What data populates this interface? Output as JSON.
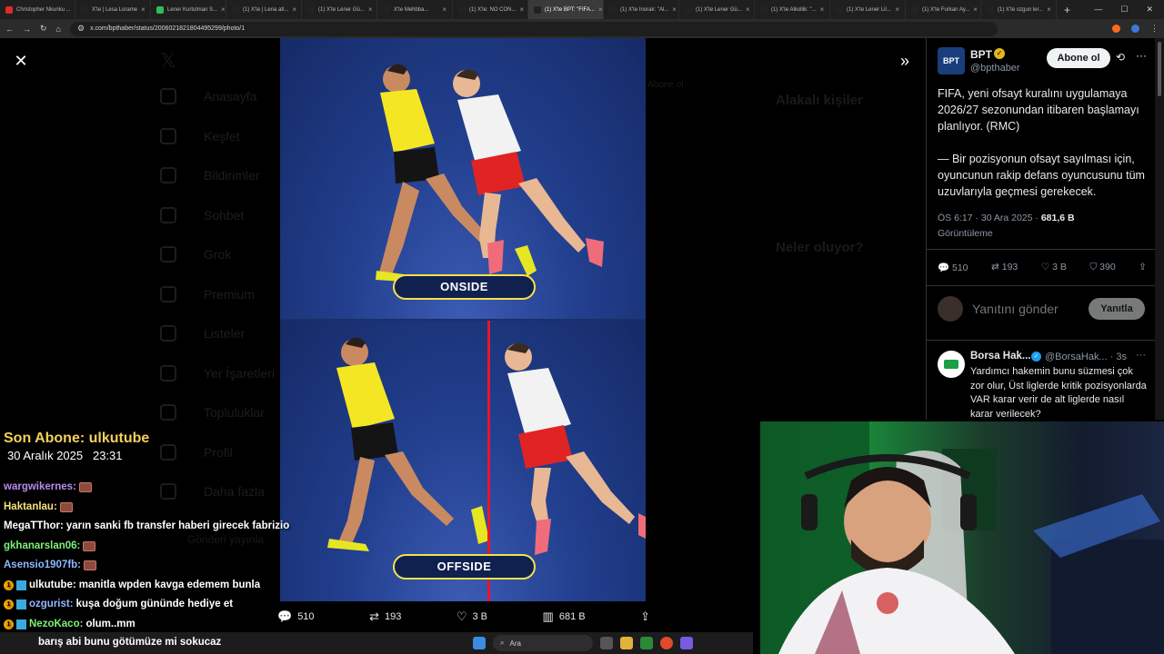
{
  "browser": {
    "tabs": [
      {
        "label": "Christopher Nkunku ...",
        "icon_color": "#e02a2a",
        "active": false
      },
      {
        "label": "X'te | Lesa Lorame",
        "icon_color": "#222222",
        "active": false
      },
      {
        "label": "Lener Kurtulman S...",
        "icon_color": "#2ebd59",
        "active": false
      },
      {
        "label": "(1) X'te | Lena atl...",
        "icon_color": "#222222",
        "active": false
      },
      {
        "label": "(1) X'te Lener Gü...",
        "icon_color": "#222222",
        "active": false
      },
      {
        "label": "X'te Mehbba...",
        "icon_color": "#222222",
        "active": false
      },
      {
        "label": "(1) X'te: NO CON...",
        "icon_color": "#222222",
        "active": false
      },
      {
        "label": "(1) X'te BPT: \"FIFA...",
        "icon_color": "#222222",
        "active": true
      },
      {
        "label": "(1) X'te Inorak: \"Al...",
        "icon_color": "#222222",
        "active": false
      },
      {
        "label": "(1) X'te Lener Gü...",
        "icon_color": "#222222",
        "active": false
      },
      {
        "label": "(1) X'te Alkollik: \"...",
        "icon_color": "#222222",
        "active": false
      },
      {
        "label": "(1) X'te Lener Lil...",
        "icon_color": "#222222",
        "active": false
      },
      {
        "label": "(1) X'te Furkan Ay...",
        "icon_color": "#222222",
        "active": false
      },
      {
        "label": "(1) X'te ozgun ler...",
        "icon_color": "#222222",
        "active": false
      }
    ],
    "new_tab": "+",
    "url": "x.com/bpthaber/status/2006021821804495299/photo/1"
  },
  "background_page": {
    "nav": [
      "Anasayfa",
      "Keşfet",
      "Bildirimler",
      "Sohbet",
      "Grok",
      "Premium",
      "Listeler",
      "Yer İşaretleri",
      "Topluluklar",
      "Profil",
      "Daha fazla"
    ],
    "post_button": "Gönderi yayınla",
    "sidebar_title_1": "Alakalı kişiler",
    "sidebar_title_2": "Neler oluyor?",
    "follow_chip": "Abone ol"
  },
  "photo": {
    "top_label": "ONSIDE",
    "bottom_label": "OFFSIDE"
  },
  "photo_actions": {
    "replies": "510",
    "reposts": "193",
    "likes": "3 B",
    "views": "681 B"
  },
  "tweet": {
    "avatar_text": "BPT",
    "author_name": "BPT",
    "author_handle": "@bpthaber",
    "follow_label": "Abone ol",
    "text": "FIFA, yeni ofsayt kuralını uygulamaya 2026/27 sezonundan itibaren başlamayı planlıyor. (RMC)\n\n— Bir pozisyonun ofsayt sayılması için, oyuncunun rakip defans oyuncusunu tüm uzuvlarıyla geçmesi gerekecek.",
    "time": "ÖS 6:17 · 30 Ara 2025 · ",
    "views": "681,6 B",
    "views_label": "Görüntüleme",
    "replies": "510",
    "reposts": "193",
    "likes": "3 B",
    "bookmarks": "390",
    "reply_placeholder": "Yanıtını gönder",
    "reply_button": "Yanıtla"
  },
  "reply": {
    "name": "Borsa Hak...",
    "handle": "@BorsaHak... · 3s",
    "text": "Yardımcı hakemin bunu süzmesi çok zor olur, Üst liglerde kritik pozisyonlarda VAR karar verir de alt liglerde nasıl karar verilecek?"
  },
  "stream": {
    "sub_title": "Son Abone: ulkutube",
    "sub_date": "30 Aralık 2025",
    "sub_time": "23:31",
    "chat": [
      {
        "user": "wargwikernes:",
        "color": "#b98cf0",
        "text": "",
        "emote": true,
        "badges": false
      },
      {
        "user": "Haktanlau:",
        "color": "#f6e27a",
        "text": "",
        "emote": true,
        "badges": false
      },
      {
        "user": "MegaTThor:",
        "color": "#ffffff",
        "text": "yarın sanki fb transfer haberi girecek fabrizio",
        "emote": false,
        "badges": false
      },
      {
        "user": "gkhanarslan06:",
        "color": "#7ef07a",
        "text": "",
        "emote": true,
        "badges": false
      },
      {
        "user": "Asensio1907fb:",
        "color": "#8fb8ff",
        "text": "",
        "emote": true,
        "badges": false
      },
      {
        "user": "ulkutube:",
        "color": "#ffffff",
        "text": "manitla wpden kavga edemem bunla",
        "emote": false,
        "badges": true
      },
      {
        "user": "ozgurist:",
        "color": "#8fb8ff",
        "text": "kuşa doğum gününde hediye et",
        "emote": false,
        "badges": true
      },
      {
        "user": "NezoKaco:",
        "color": "#7ef07a",
        "text": "olum..mm",
        "emote": false,
        "badges": true
      }
    ],
    "last_message": "barış abi bunu götümüze mi sokucaz"
  },
  "taskbar": {
    "search_label": "Ara"
  }
}
